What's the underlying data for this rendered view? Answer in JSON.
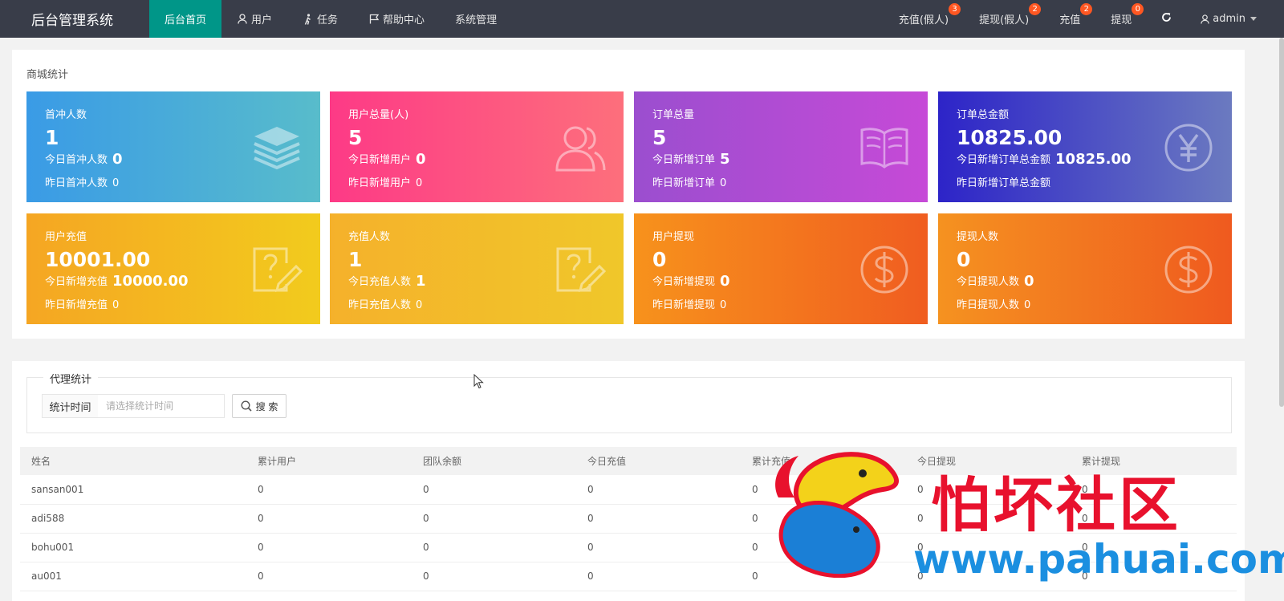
{
  "header": {
    "brand": "后台管理系统",
    "nav": [
      {
        "label": "后台首页",
        "icon": "none",
        "active": true
      },
      {
        "label": "用户",
        "icon": "user-icon",
        "active": false
      },
      {
        "label": "任务",
        "icon": "walk-icon",
        "active": false
      },
      {
        "label": "帮助中心",
        "icon": "flag-icon",
        "active": false
      },
      {
        "label": "系统管理",
        "icon": "none",
        "active": false
      }
    ],
    "right": [
      {
        "label": "充值(假人)",
        "badge": "3"
      },
      {
        "label": "提现(假人)",
        "badge": "2"
      },
      {
        "label": "充值",
        "badge": "2"
      },
      {
        "label": "提现",
        "badge": "0"
      }
    ],
    "refresh_icon": "refresh-icon",
    "user": "admin"
  },
  "stats": {
    "title": "商城统计",
    "cards": [
      {
        "title": "首冲人数",
        "value": "1",
        "today_label": "今日首冲人数",
        "today_value": "0",
        "yesterday_label": "昨日首冲人数",
        "yesterday_value": "0",
        "icon": "layers-icon",
        "color": "#3a9be6"
      },
      {
        "title": "用户总量(人)",
        "value": "5",
        "today_label": "今日新增用户",
        "today_value": "0",
        "yesterday_label": "昨日新增用户",
        "yesterday_value": "0",
        "icon": "users-icon",
        "color": "#fd3a86"
      },
      {
        "title": "订单总量",
        "value": "5",
        "today_label": "今日新增订单",
        "today_value": "5",
        "yesterday_label": "昨日新增订单",
        "yesterday_value": "0",
        "icon": "book-icon",
        "color": "#9b4ecf"
      },
      {
        "title": "订单总金额",
        "value": "10825.00",
        "today_label": "今日新增订单总金额",
        "today_value": "10825.00",
        "yesterday_label": "昨日新增订单总金额",
        "yesterday_value": "",
        "icon": "yuan-icon",
        "color": "#2d24c8"
      },
      {
        "title": "用户充值",
        "value": "10001.00",
        "today_label": "今日新增充值",
        "today_value": "10000.00",
        "yesterday_label": "昨日新增充值",
        "yesterday_value": "0",
        "icon": "question-note-icon",
        "color": "#f5a623"
      },
      {
        "title": "充值人数",
        "value": "1",
        "today_label": "今日充值人数",
        "today_value": "1",
        "yesterday_label": "昨日充值人数",
        "yesterday_value": "0",
        "icon": "question-note-icon",
        "color": "#f5b12b"
      },
      {
        "title": "用户提现",
        "value": "0",
        "today_label": "今日新增提现",
        "today_value": "0",
        "yesterday_label": "昨日新增提现",
        "yesterday_value": "0",
        "icon": "dollar-icon",
        "color": "#f7921c"
      },
      {
        "title": "提现人数",
        "value": "0",
        "today_label": "今日提现人数",
        "today_value": "0",
        "yesterday_label": "昨日提现人数",
        "yesterday_value": "0",
        "icon": "dollar-icon",
        "color": "#f59220"
      }
    ]
  },
  "agent": {
    "legend": "代理统计",
    "filter_label": "统计时间",
    "filter_placeholder": "请选择统计时间",
    "search_label": "搜 索",
    "columns": [
      "姓名",
      "累计用户",
      "团队余额",
      "今日充值",
      "累计充值",
      "今日提现",
      "累计提现"
    ],
    "rows": [
      [
        "sansan001",
        "0",
        "0",
        "0",
        "0",
        "0",
        "0"
      ],
      [
        "adi588",
        "0",
        "0",
        "0",
        "0",
        "0",
        "0"
      ],
      [
        "bohu001",
        "0",
        "0",
        "0",
        "0",
        "0",
        "0"
      ],
      [
        "au001",
        "0",
        "0",
        "0",
        "0",
        "0",
        "0"
      ]
    ]
  },
  "watermark": {
    "text": "怕坏社区",
    "url": "www.pahuai.com"
  }
}
